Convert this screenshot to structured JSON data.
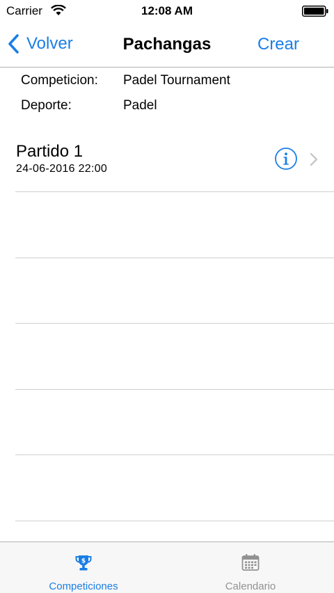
{
  "status_bar": {
    "carrier": "Carrier",
    "time": "12:08 AM",
    "wifi_icon": "wifi-icon",
    "battery_icon": "battery-icon"
  },
  "nav": {
    "back_label": "Volver",
    "title": "Pachangas",
    "action_label": "Crear",
    "tint_color": "#1a7ee6"
  },
  "info": {
    "competition_label": "Competicion:",
    "competition_value": "Padel Tournament",
    "sport_label": "Deporte:",
    "sport_value": "Padel"
  },
  "matches": [
    {
      "name": "Partido 1",
      "date": "24-06-2016 22:00",
      "accessory_icon": "info-icon"
    }
  ],
  "tab_bar": {
    "tabs": [
      {
        "label": "Competiciones",
        "icon": "trophy-icon",
        "selected": true,
        "color": "#1a7ee6"
      },
      {
        "label": "Calendario",
        "icon": "calendar-icon",
        "selected": false,
        "color": "#929292"
      }
    ]
  }
}
